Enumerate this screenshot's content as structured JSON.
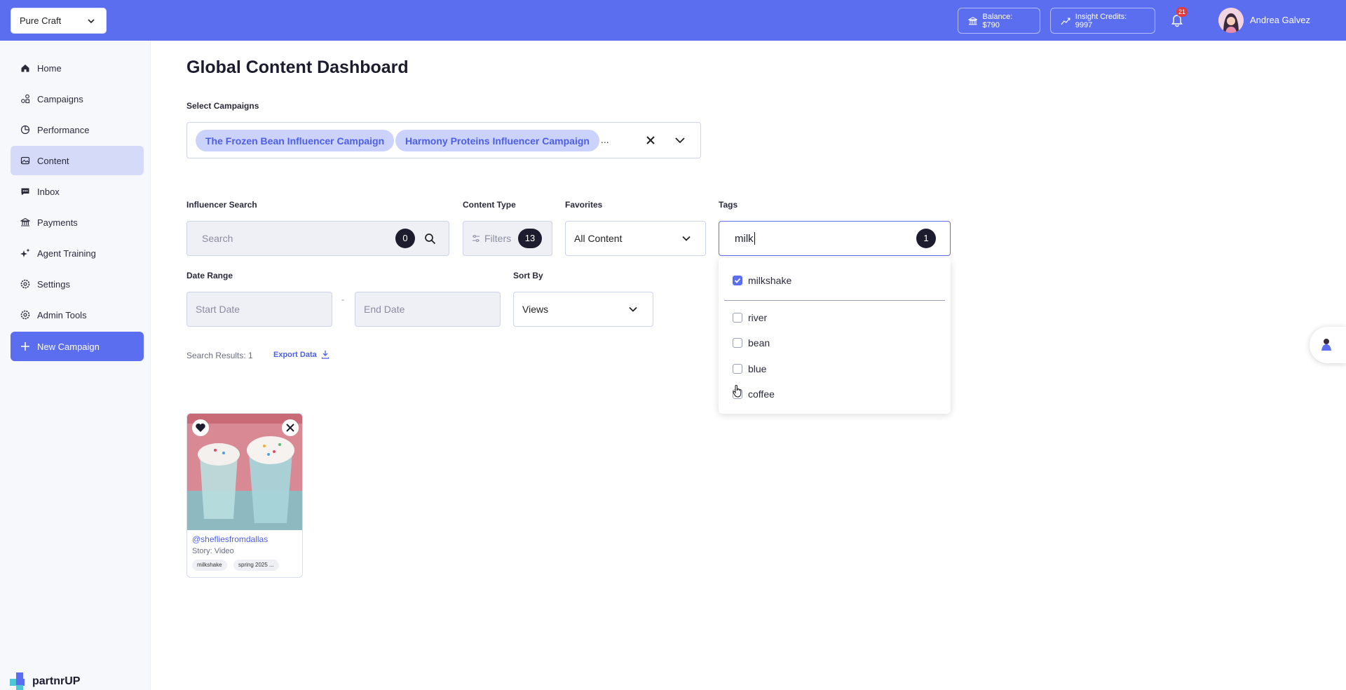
{
  "topbar": {
    "brand_selector": "Pure Craft",
    "balance": "Balance: $790",
    "insight_credits": "Insight Credits: 9997",
    "notification_count": "21",
    "user_name": "Andrea Galvez"
  },
  "sidebar": {
    "items": [
      {
        "label": "Home",
        "icon": "home-icon"
      },
      {
        "label": "Campaigns",
        "icon": "campaigns-icon"
      },
      {
        "label": "Performance",
        "icon": "performance-icon"
      },
      {
        "label": "Content",
        "icon": "content-icon"
      },
      {
        "label": "Inbox",
        "icon": "inbox-icon"
      },
      {
        "label": "Payments",
        "icon": "payments-icon"
      },
      {
        "label": "Agent Training",
        "icon": "sparkle-icon"
      },
      {
        "label": "Settings",
        "icon": "gear-icon"
      },
      {
        "label": "Admin Tools",
        "icon": "gear-icon"
      }
    ],
    "new_campaign": "New Campaign",
    "logo_text": "partnrUP"
  },
  "main": {
    "title": "Global Content Dashboard",
    "select_campaigns_label": "Select Campaigns",
    "selected_campaigns": [
      "The Frozen Bean Influencer Campaign",
      "Harmony Proteins Influencer Campaign"
    ],
    "more_indicator": "...",
    "influencer_search": {
      "label": "Influencer Search",
      "placeholder": "Search",
      "count": "0"
    },
    "content_type": {
      "label": "Content Type",
      "placeholder": "Filters",
      "count": "13"
    },
    "favorites": {
      "label": "Favorites",
      "value": "All Content"
    },
    "tags": {
      "label": "Tags",
      "value": "milk",
      "count": "1"
    },
    "date_range": {
      "label": "Date Range",
      "start_placeholder": "Start Date",
      "separator": "-",
      "end_placeholder": "End Date"
    },
    "sort_by": {
      "label": "Sort By",
      "value": "Views"
    },
    "search_results": "Search Results: 1",
    "export": "Export Data"
  },
  "tag_dropdown": {
    "options": [
      {
        "label": "milkshake",
        "checked": true
      },
      {
        "label": "river",
        "checked": false
      },
      {
        "label": "bean",
        "checked": false
      },
      {
        "label": "blue",
        "checked": false
      },
      {
        "label": "coffee",
        "checked": false
      }
    ]
  },
  "content_card": {
    "handle": "@shefliesfromdallas",
    "type": "Story: Video",
    "tags": [
      "milkshake",
      "spring 2025 ..."
    ]
  },
  "colors": {
    "accent": "#5b6ef0",
    "chip_bg": "#cbd2fb",
    "active_nav": "#d5daf9",
    "badge": "#1c1c2e"
  }
}
